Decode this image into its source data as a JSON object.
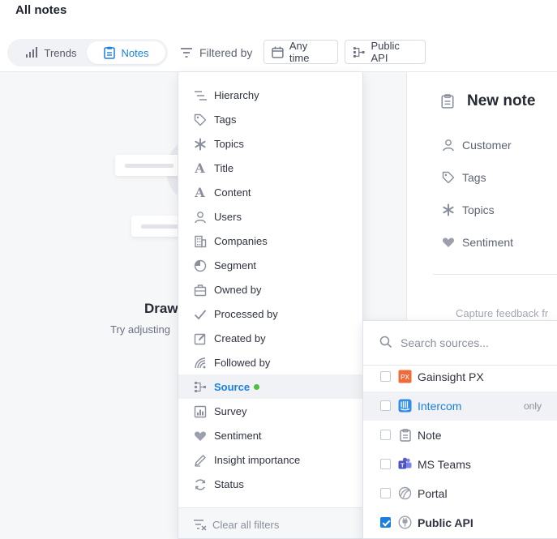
{
  "page": {
    "title": "All notes"
  },
  "toolbar": {
    "trends_label": "Trends",
    "notes_label": "Notes",
    "filtered_by_label": "Filtered by",
    "any_time_label": "Any time",
    "public_api_label": "Public API"
  },
  "empty_state": {
    "title_fragment": "Draw",
    "subtitle_fragment": "Try adjusting"
  },
  "new_note": {
    "title": "New note",
    "fields": [
      "Customer",
      "Tags",
      "Topics",
      "Sentiment"
    ],
    "capture_text": "Capture feedback fr"
  },
  "filter_menu": {
    "items": [
      {
        "label": "Hierarchy",
        "icon": "hierarchy-icon"
      },
      {
        "label": "Tags",
        "icon": "tag-icon"
      },
      {
        "label": "Topics",
        "icon": "asterisk-icon"
      },
      {
        "label": "Title",
        "icon": "letter-a-icon"
      },
      {
        "label": "Content",
        "icon": "letter-a-icon"
      },
      {
        "label": "Users",
        "icon": "user-icon"
      },
      {
        "label": "Companies",
        "icon": "building-icon"
      },
      {
        "label": "Segment",
        "icon": "pie-icon"
      },
      {
        "label": "Owned by",
        "icon": "briefcase-icon"
      },
      {
        "label": "Processed by",
        "icon": "check-icon"
      },
      {
        "label": "Created by",
        "icon": "edit-icon"
      },
      {
        "label": "Followed by",
        "icon": "signal-icon"
      },
      {
        "label": "Source",
        "icon": "source-icon",
        "active": true
      },
      {
        "label": "Survey",
        "icon": "chart-box-icon"
      },
      {
        "label": "Sentiment",
        "icon": "heart-icon"
      },
      {
        "label": "Insight importance",
        "icon": "pencil-icon"
      },
      {
        "label": "Status",
        "icon": "refresh-icon"
      }
    ],
    "clear_label": "Clear all filters"
  },
  "source_menu": {
    "search_placeholder": "Search sources...",
    "only_label": "only",
    "items": [
      {
        "label": "Gainsight PX",
        "checked": false
      },
      {
        "label": "Intercom",
        "checked": false
      },
      {
        "label": "Note",
        "checked": false
      },
      {
        "label": "MS Teams",
        "checked": false
      },
      {
        "label": "Portal",
        "checked": false
      },
      {
        "label": "Public API",
        "checked": true
      }
    ]
  },
  "colors": {
    "accent": "#1a7fe0",
    "active_dot": "#4cc13d",
    "intercom_blue": "#2f8fe8",
    "gainsight_orange": "#f06a3c",
    "teams_purple": "#5b5fc7"
  }
}
